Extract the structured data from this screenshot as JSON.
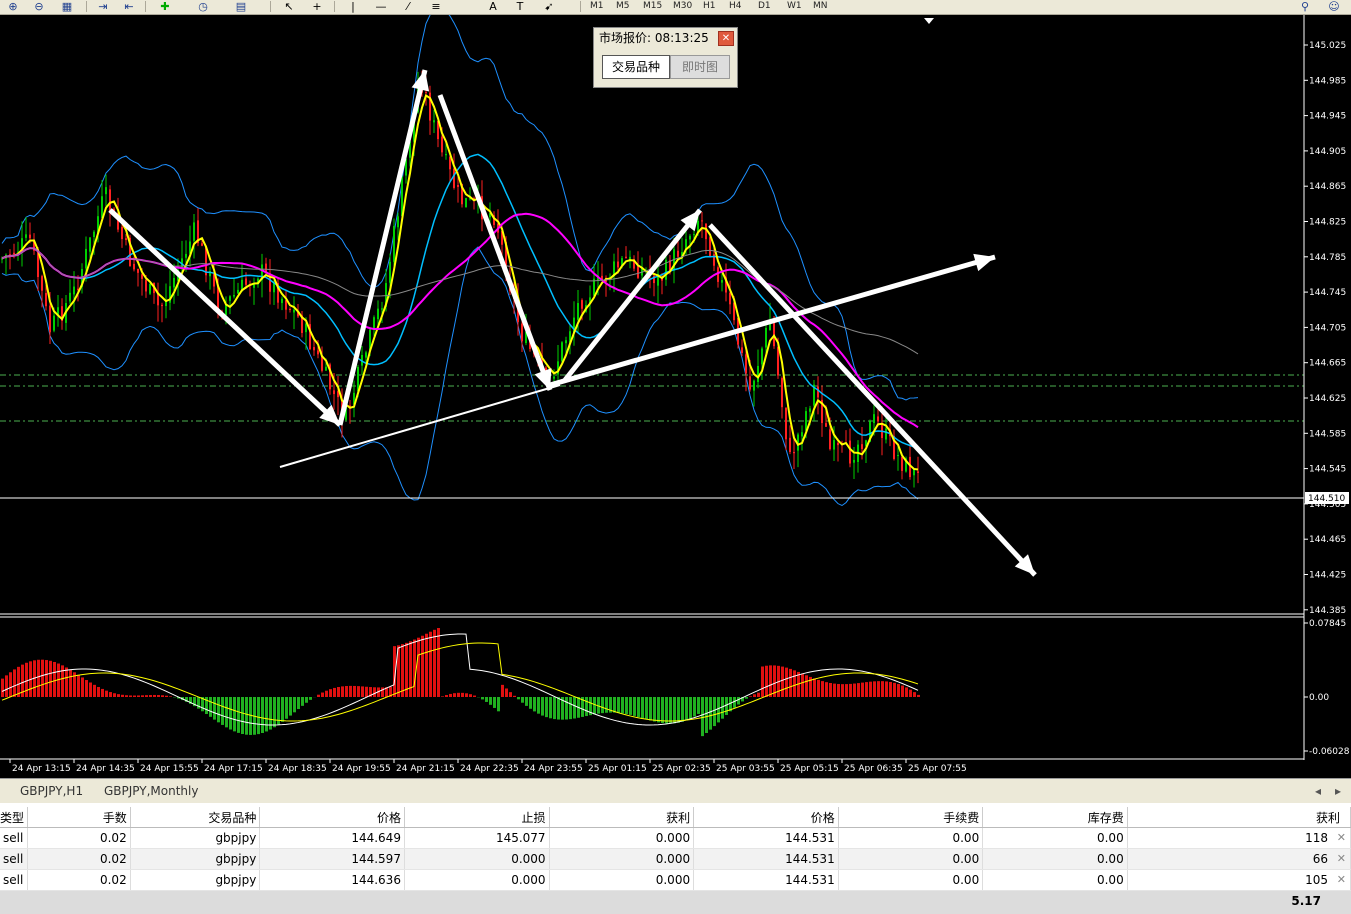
{
  "toolbar": {
    "timeframes": [
      "M1",
      "M5",
      "M15",
      "M30",
      "H1",
      "H4",
      "D1",
      "W1",
      "MN"
    ]
  },
  "market_window": {
    "title": "市场报价: 08:13:25",
    "tab_symbols": "交易品种",
    "tab_tick": "即时图"
  },
  "chart": {
    "price_ticks": [
      "145.025",
      "144.985",
      "144.945",
      "144.905",
      "144.865",
      "144.825",
      "144.785",
      "144.745",
      "144.705",
      "144.665",
      "144.625",
      "144.585",
      "144.545",
      "144.505",
      "144.465",
      "144.425",
      "144.385"
    ],
    "current_price": "144.510",
    "osc_ticks": [
      "0.07845",
      "0.00",
      "-0.06028"
    ],
    "time_labels": [
      "24 Apr 13:15",
      "24 Apr 14:35",
      "24 Apr 15:55",
      "24 Apr 17:15",
      "24 Apr 18:35",
      "24 Apr 19:55",
      "24 Apr 21:15",
      "24 Apr 22:35",
      "24 Apr 23:55",
      "25 Apr 01:15",
      "25 Apr 02:35",
      "25 Apr 03:55",
      "25 Apr 05:15",
      "25 Apr 06:35",
      "25 Apr 07:55"
    ],
    "colors": {
      "up": "#00d000",
      "down": "#ff2020",
      "yellow": "#ffff00",
      "cyan": "#00bfff",
      "magenta": "#ff00ff",
      "band": "#1e90ff"
    }
  },
  "symbol_tabs": [
    "GBPJPY,H1",
    "GBPJPY,Monthly"
  ],
  "terminal": {
    "headers": [
      "类型",
      "手数",
      "交易品种",
      "价格",
      "止损",
      "获利",
      "价格",
      "手续费",
      "库存费",
      "获利"
    ],
    "rows": [
      [
        "sell",
        "0.02",
        "gbpjpy",
        "144.649",
        "145.077",
        "0.000",
        "144.531",
        "0.00",
        "0.00",
        "118"
      ],
      [
        "sell",
        "0.02",
        "gbpjpy",
        "144.597",
        "0.000",
        "0.000",
        "144.531",
        "0.00",
        "0.00",
        "66"
      ],
      [
        "sell",
        "0.02",
        "gbpjpy",
        "144.636",
        "0.000",
        "0.000",
        "144.531",
        "0.00",
        "0.00",
        "105"
      ]
    ],
    "total": "5.17"
  }
}
